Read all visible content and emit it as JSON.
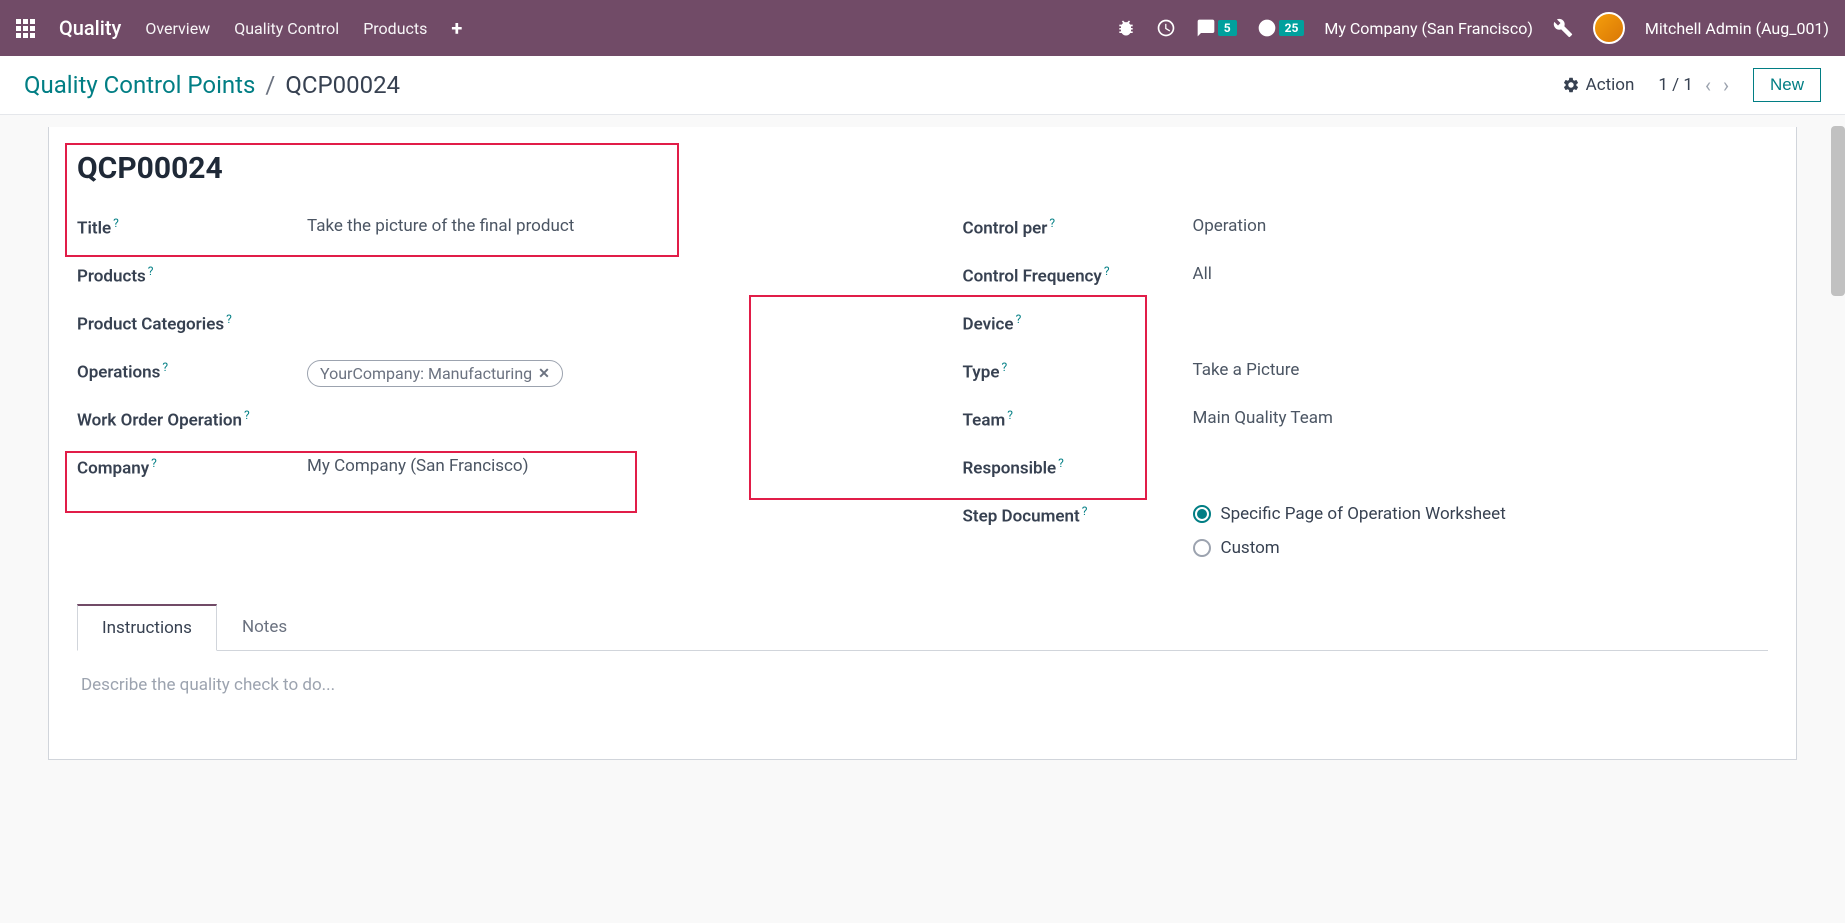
{
  "navbar": {
    "app_name": "Quality",
    "links": [
      "Overview",
      "Quality Control",
      "Products"
    ],
    "badge_chat": "5",
    "badge_activity": "25",
    "company": "My Company (San Francisco)",
    "user": "Mitchell Admin (Aug_001)"
  },
  "breadcrumb": {
    "parent": "Quality Control Points",
    "current": "QCP00024"
  },
  "action_bar": {
    "action_label": "Action",
    "pager": "1 / 1",
    "new_label": "New"
  },
  "record": {
    "name": "QCP00024",
    "labels": {
      "title": "Title",
      "products": "Products",
      "product_categories": "Product Categories",
      "operations": "Operations",
      "work_order_operation": "Work Order Operation",
      "company": "Company",
      "control_per": "Control per",
      "control_frequency": "Control Frequency",
      "device": "Device",
      "type": "Type",
      "team": "Team",
      "responsible": "Responsible",
      "step_document": "Step Document"
    },
    "values": {
      "title": "Take the picture of the final product",
      "operations_tag": "YourCompany: Manufacturing",
      "company": "My Company (San Francisco)",
      "control_per": "Operation",
      "control_frequency": "All",
      "type": "Take a Picture",
      "team": "Main Quality Team"
    },
    "step_document_options": {
      "specific": "Specific Page of Operation Worksheet",
      "custom": "Custom"
    }
  },
  "tabs": {
    "instructions": "Instructions",
    "notes": "Notes"
  },
  "instructions_placeholder": "Describe the quality check to do..."
}
